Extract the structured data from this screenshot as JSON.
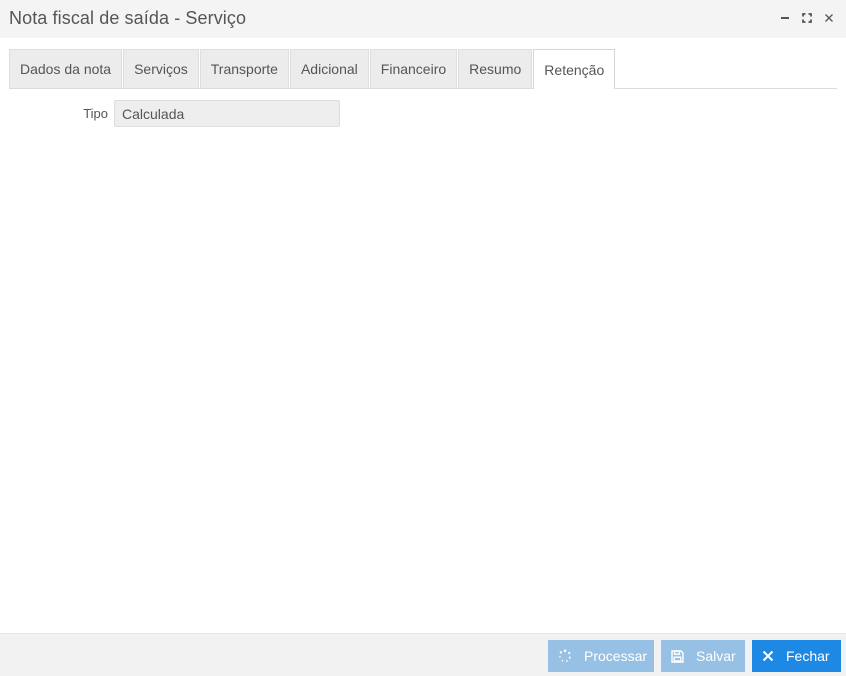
{
  "window": {
    "title": "Nota fiscal de saída - Serviço",
    "controls": [
      "minimize-icon",
      "maximize-icon",
      "close-icon"
    ]
  },
  "tabs": [
    {
      "label": "Dados da nota",
      "active": false
    },
    {
      "label": "Serviços",
      "active": false
    },
    {
      "label": "Transporte",
      "active": false
    },
    {
      "label": "Adicional",
      "active": false
    },
    {
      "label": "Financeiro",
      "active": false
    },
    {
      "label": "Resumo",
      "active": false
    },
    {
      "label": "Retenção",
      "active": true
    }
  ],
  "form": {
    "tipo_label": "Tipo",
    "tipo_value": "Calculada"
  },
  "footer": {
    "processar_label": "Processar",
    "salvar_label": "Salvar",
    "fechar_label": "Fechar"
  },
  "colors": {
    "primary": "#1e88e5",
    "disabled": "#97c1e4"
  }
}
